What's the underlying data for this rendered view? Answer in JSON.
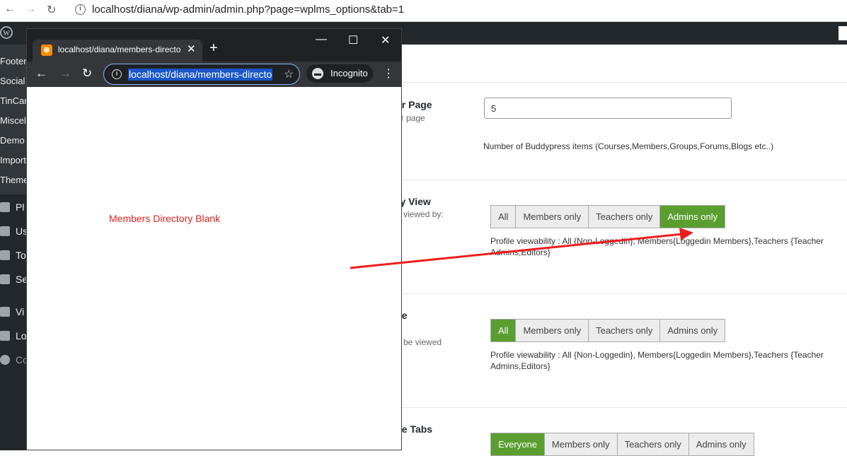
{
  "outer_browser": {
    "back_icon": "back-arrow-icon",
    "forward_icon": "forward-arrow-icon",
    "reload_icon": "reload-icon",
    "url": "localhost/diana/wp-admin/admin.php?page=wplms_options&tab=1"
  },
  "wp_sidebar": {
    "sub_items": [
      "Footer",
      "Social",
      "TinCan",
      "Miscel",
      "Demo",
      "Import",
      "Theme"
    ],
    "main_items": [
      {
        "icon": "plugins-icon",
        "label": "Pl"
      },
      {
        "icon": "users-icon",
        "label": "Us"
      },
      {
        "icon": "tools-icon",
        "label": "To"
      },
      {
        "icon": "settings-icon",
        "label": "Se"
      },
      {
        "icon": "vibe-icon",
        "label": "Vi"
      },
      {
        "icon": "lms-icon",
        "label": "Lo"
      },
      {
        "icon": "collapse-icon",
        "label": "Co"
      }
    ]
  },
  "settings": {
    "items_per_page": {
      "title": "er Page",
      "subtitle": "er page",
      "value": "5",
      "description": "Number of Buddypress items (Courses,Members,Groups,Forums,Blogs etc..)"
    },
    "directory_view": {
      "title": "ry View",
      "subtitle": "e viewed by:",
      "options": [
        "All",
        "Members only",
        "Teachers only",
        "Admins only"
      ],
      "selected": "Admins only",
      "description_line1": "Profile viewability : All {Non-Loggedin}, Members{Loggedin Members},Teachers {Teacher",
      "description_line2": "Admins,Editors}"
    },
    "profile": {
      "title": "ile",
      "subtitle": "n be viewed",
      "options": [
        "All",
        "Members only",
        "Teachers only",
        "Admins only"
      ],
      "selected": "All",
      "description_line1": "Profile viewability : All {Non-Loggedin}, Members{Loggedin Members},Teachers {Teacher",
      "description_line2": "Admins,Editors}"
    },
    "profile_tabs": {
      "title": "ile Tabs",
      "options": [
        "Everyone",
        "Members only",
        "Teachers only",
        "Admins only"
      ],
      "selected": "Everyone"
    }
  },
  "popup": {
    "tab_title": "localhost/diana/members-directo",
    "favicon_icon": "xampp-icon",
    "url": "localhost/diana/members-directo",
    "incognito_label": "Incognito",
    "content_message": "Members Directory Blank"
  },
  "colors": {
    "active_green": "#5a9e30",
    "wp_dark": "#23282d",
    "annotation_red": "#ee1c1c",
    "incognito_dark": "#202124"
  }
}
